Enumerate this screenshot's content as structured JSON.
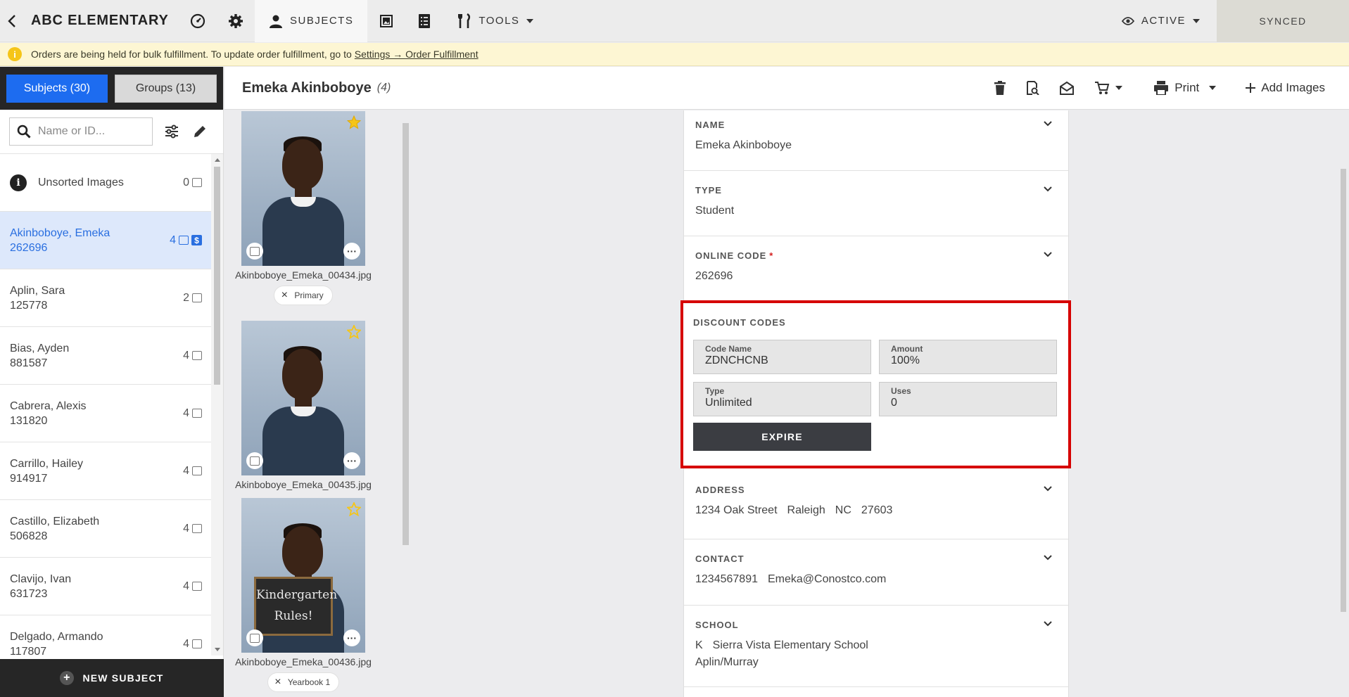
{
  "topbar": {
    "title": "ABC ELEMENTARY",
    "tabs": [
      {
        "label": "SUBJECTS"
      },
      {
        "label": "TOOLS"
      }
    ],
    "active_filter": "ACTIVE",
    "sync_status": "SYNCED"
  },
  "banner": {
    "text": "Orders are being held for bulk fulfillment. To update order fulfillment, go to",
    "link": "Settings → Order Fulfillment"
  },
  "sidebar": {
    "tabs": [
      "Subjects (30)",
      "Groups (13)"
    ],
    "search_placeholder": "Name or ID...",
    "unsorted": {
      "label": "Unsorted Images",
      "count": "0"
    },
    "subjects": [
      {
        "name": "Akinboboye, Emeka",
        "id": "262696",
        "count": "4"
      },
      {
        "name": "Aplin, Sara",
        "id": "125778",
        "count": "2"
      },
      {
        "name": "Bias, Ayden",
        "id": "881587",
        "count": "4"
      },
      {
        "name": "Cabrera, Alexis",
        "id": "131820",
        "count": "4"
      },
      {
        "name": "Carrillo, Hailey",
        "id": "914917",
        "count": "4"
      },
      {
        "name": "Castillo, Elizabeth",
        "id": "506828",
        "count": "4"
      },
      {
        "name": "Clavijo, Ivan",
        "id": "631723",
        "count": "4"
      },
      {
        "name": "Delgado, Armando",
        "id": "117807",
        "count": "4"
      }
    ],
    "selected_badge": "$",
    "new_subject": "NEW SUBJECT"
  },
  "header": {
    "subject_name": "Emeka Akinboboye",
    "image_count": "(4)",
    "print_label": "Print",
    "add_images_label": "Add Images"
  },
  "photos": [
    {
      "file": "Akinboboye_Emeka_00434.jpg",
      "tag": "Primary",
      "starred": true
    },
    {
      "file": "Akinboboye_Emeka_00435.jpg",
      "starred": false
    },
    {
      "file": "Akinboboye_Emeka_00436.jpg",
      "tag": "Yearbook 1",
      "starred": false,
      "sign_line1": "Kindergarten",
      "sign_line2": "Rules!"
    }
  ],
  "details": {
    "name": {
      "label": "NAME",
      "value": "Emeka Akinboboye"
    },
    "type": {
      "label": "TYPE",
      "value": "Student"
    },
    "online_code": {
      "label": "ONLINE CODE",
      "required_mark": "*",
      "value": "262696"
    },
    "discount_codes": {
      "label": "DISCOUNT CODES",
      "code_name_label": "Code Name",
      "code_name": "ZDNCHCNB",
      "amount_label": "Amount",
      "amount": "100%",
      "type_label": "Type",
      "type": "Unlimited",
      "uses_label": "Uses",
      "uses": "0",
      "expire_button": "EXPIRE"
    },
    "address": {
      "label": "ADDRESS",
      "street": "1234 Oak Street",
      "city": "Raleigh",
      "state": "NC",
      "zip": "27603"
    },
    "contact": {
      "label": "CONTACT",
      "phone": "1234567891",
      "email": "Emeka@Conostco.com"
    },
    "school": {
      "label": "SCHOOL",
      "grade": "K",
      "school_name": "Sierra Vista Elementary School",
      "teacher": "Aplin/Murray"
    }
  },
  "colors": {
    "accent": "#1d6cf0",
    "highlight_border": "#d60000",
    "banner_bg": "#fdf6d3"
  }
}
